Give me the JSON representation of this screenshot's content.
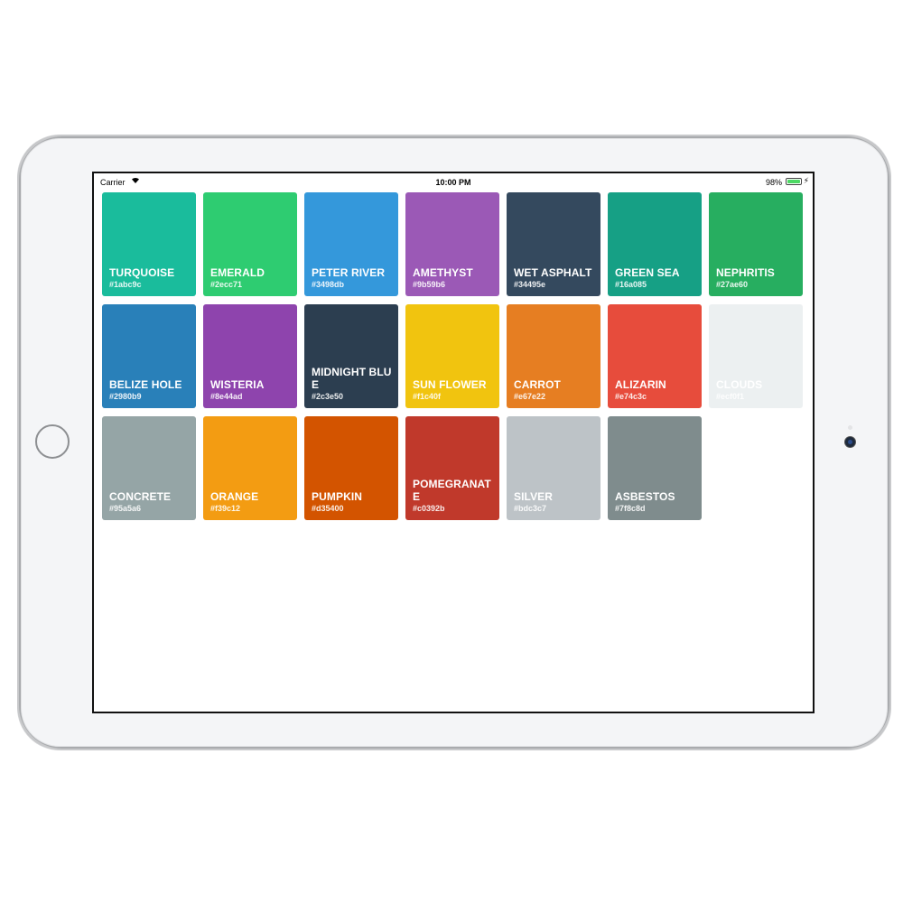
{
  "status_bar": {
    "carrier": "Carrier",
    "wifi_icon": "wifi-icon",
    "time": "10:00 PM",
    "battery_percent": "98%",
    "battery_level": 0.98,
    "battery_color": "#4cd964",
    "charging_icon": "bolt-icon"
  },
  "colors": [
    {
      "name": "TURQUOISE",
      "hex": "#1abc9c"
    },
    {
      "name": "EMERALD",
      "hex": "#2ecc71"
    },
    {
      "name": "PETER RIVER",
      "hex": "#3498db"
    },
    {
      "name": "AMETHYST",
      "hex": "#9b59b6"
    },
    {
      "name": "WET ASPHALT",
      "hex": "#34495e"
    },
    {
      "name": "GREEN SEA",
      "hex": "#16a085"
    },
    {
      "name": "NEPHRITIS",
      "hex": "#27ae60"
    },
    {
      "name": "BELIZE HOLE",
      "hex": "#2980b9"
    },
    {
      "name": "WISTERIA",
      "hex": "#8e44ad"
    },
    {
      "name": "MIDNIGHT BLUE",
      "hex": "#2c3e50"
    },
    {
      "name": "SUN FLOWER",
      "hex": "#f1c40f"
    },
    {
      "name": "CARROT",
      "hex": "#e67e22"
    },
    {
      "name": "ALIZARIN",
      "hex": "#e74c3c"
    },
    {
      "name": "CLOUDS",
      "hex": "#ecf0f1"
    },
    {
      "name": "CONCRETE",
      "hex": "#95a5a6"
    },
    {
      "name": "ORANGE",
      "hex": "#f39c12"
    },
    {
      "name": "PUMPKIN",
      "hex": "#d35400"
    },
    {
      "name": "POMEGRANATE",
      "hex": "#c0392b"
    },
    {
      "name": "SILVER",
      "hex": "#bdc3c7"
    },
    {
      "name": "ASBESTOS",
      "hex": "#7f8c8d"
    }
  ]
}
